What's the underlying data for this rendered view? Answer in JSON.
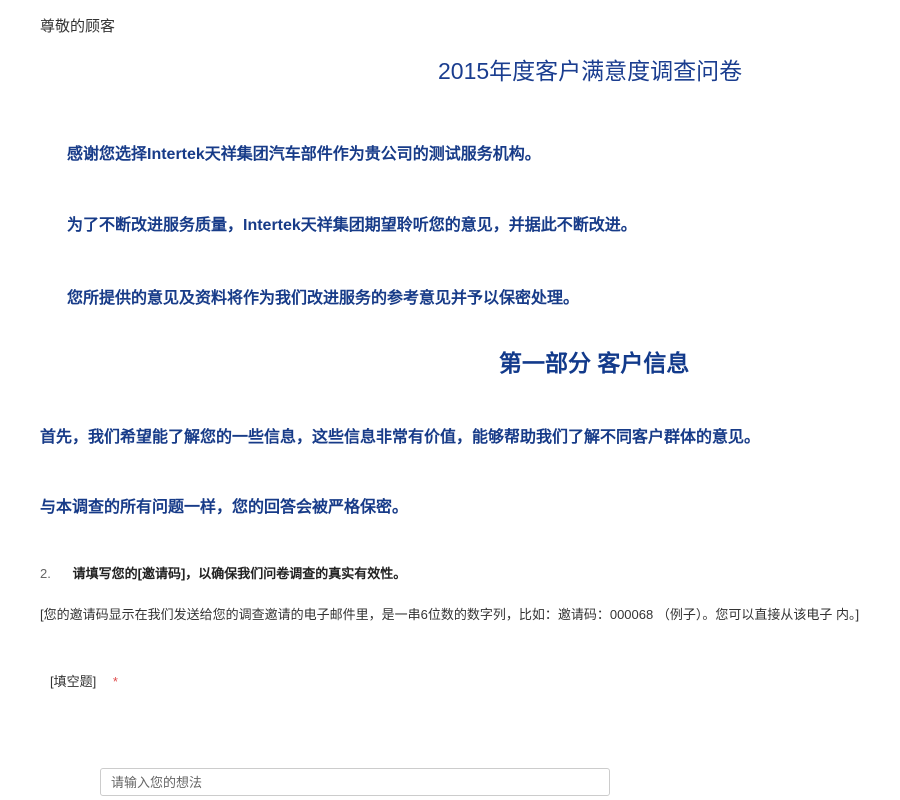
{
  "greeting": "尊敬的顾客",
  "survey_title": "2015年度客户满意度调查问卷",
  "intro": [
    "感谢您选择Intertek天祥集团汽车部件作为贵公司的测试服务机构。",
    "为了不断改进服务质量，Intertek天祥集团期望聆听您的意见，并据此不断改进。",
    "您所提供的意见及资料将作为我们改进服务的参考意见并予以保密处理。"
  ],
  "section": {
    "title": "第一部分 客户信息",
    "text": [
      "首先，我们希望能了解您的一些信息，这些信息非常有价值，能够帮助我们了解不同客户群体的意见。",
      "与本调查的所有问题一样，您的回答会被严格保密。"
    ]
  },
  "question": {
    "number": "2.",
    "text": "请填写您的[邀请码]，以确保我们问卷调查的真实有效性。",
    "description": "[您的邀请码显示在我们发送给您的调查邀请的电子邮件里，是一串6位数的数字列，比如：邀请码：000068 （例子）。您可以直接从该电子 内。]",
    "type_label": "[填空题]",
    "required_mark": "*",
    "input_value": "",
    "input_placeholder": "请输入您的想法"
  }
}
